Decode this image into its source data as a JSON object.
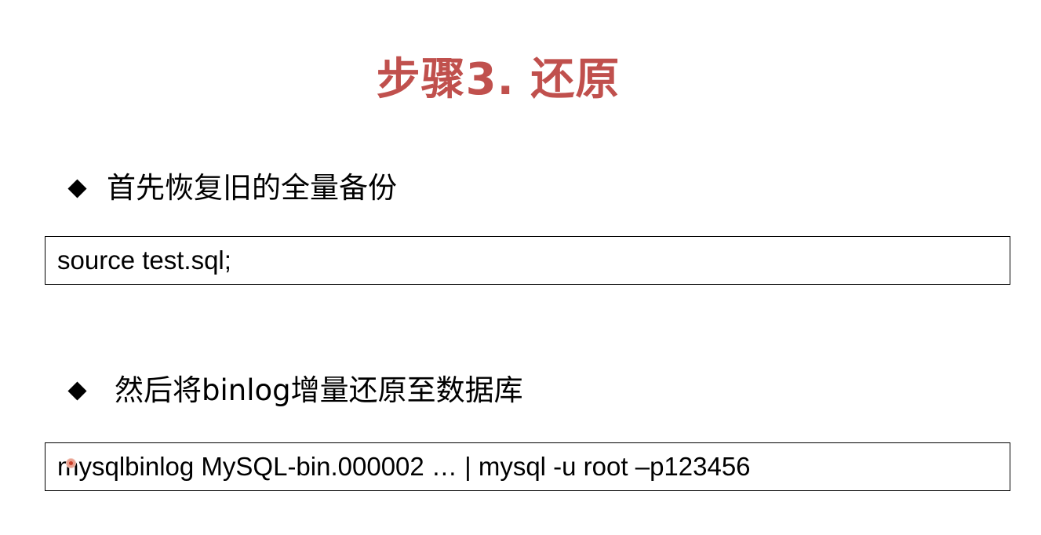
{
  "slide": {
    "title": "步骤3. 还原",
    "sections": [
      {
        "bullet": "首先恢复旧的全量备份",
        "code": "source test.sql;"
      },
      {
        "bullet": "然后将binlog增量还原至数据库",
        "code": "mysqlbinlog MySQL-bin.000002 … | mysql -u root –p123456"
      }
    ]
  },
  "colors": {
    "title": "#c0504d",
    "text": "#000000",
    "background": "#ffffff"
  },
  "icons": {
    "bullet": "diamond-bullet-icon",
    "pointer": "cursor-indicator-icon"
  }
}
